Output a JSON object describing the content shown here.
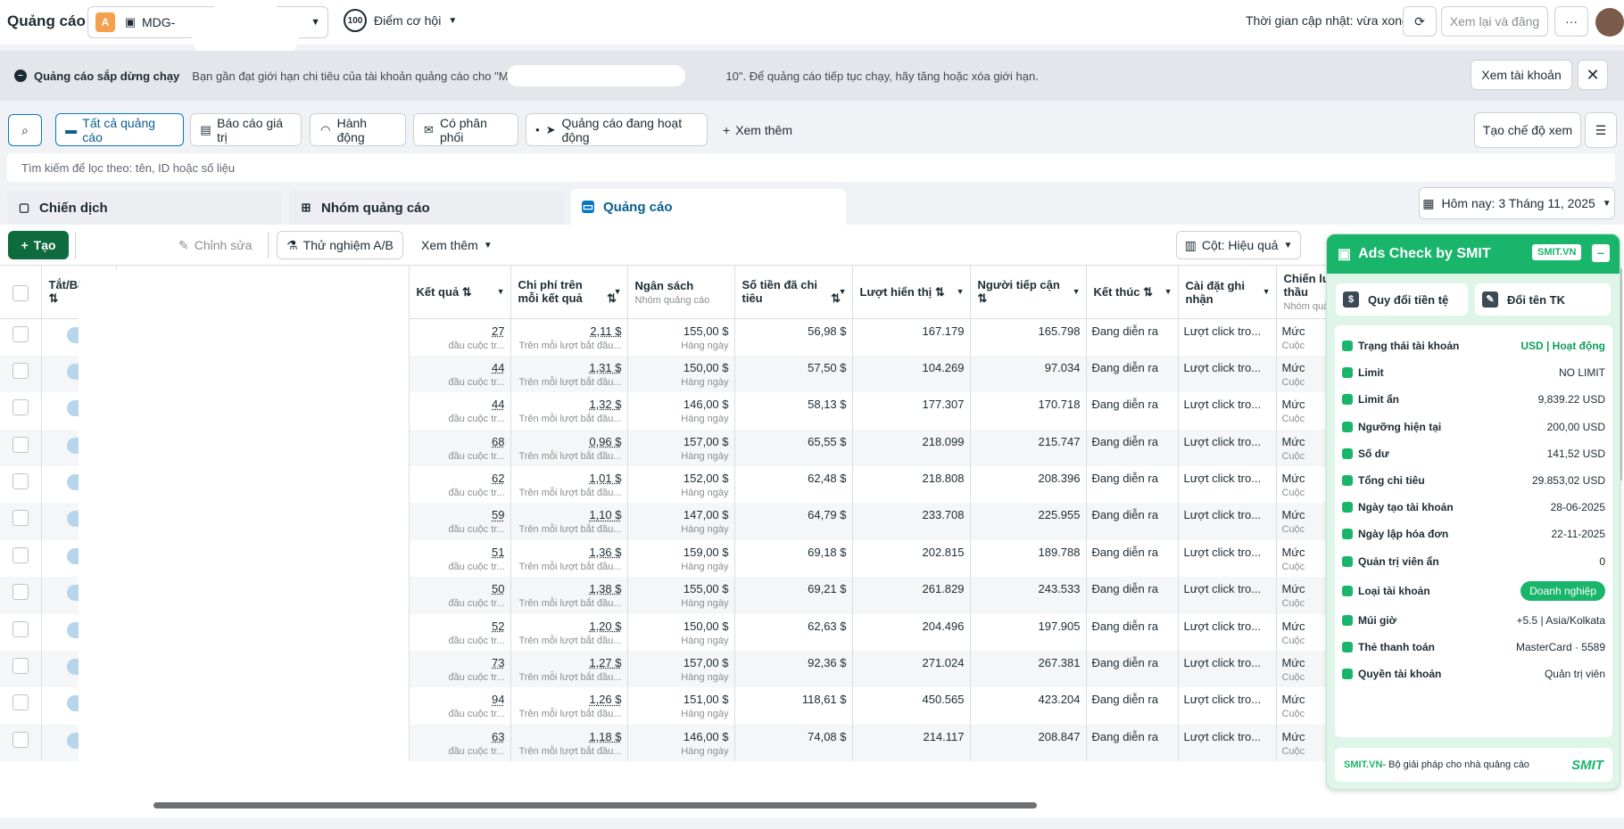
{
  "app": {
    "title": "Quảng cáo",
    "account_letter": "A",
    "account_name": "MDG-",
    "score": "100",
    "score_label": "Điểm cơ hội"
  },
  "topbar": {
    "updated": "Thời gian cập nhật: vừa xong",
    "review_label": "Xem lại và đăng",
    "more": "···"
  },
  "warning": {
    "title": "Quảng cáo sắp dừng chạy",
    "text": "Bạn gần đạt giới hạn chi tiêu của tài khoản quảng cáo cho \"MDG-",
    "text_tail": "10\". Để quảng cáo tiếp tục chạy, hãy tăng hoặc xóa giới hạn.",
    "button": "Xem tài khoản"
  },
  "filters": {
    "items": [
      "Tất cả quảng cáo",
      "Báo cáo giá trị",
      "Hành động",
      "Có phân phối",
      "Quảng cáo đang hoạt động"
    ],
    "more": "Xem thêm",
    "create_view": "Tạo chế độ xem"
  },
  "search": {
    "placeholder": "Tìm kiếm để lọc theo: tên, ID hoặc số liệu"
  },
  "tabs": [
    "Chiến dịch",
    "Nhóm quảng cáo",
    "Quảng cáo"
  ],
  "date": {
    "label": "Hôm nay: 3 Tháng 11, 2025"
  },
  "toolbar": {
    "create": "Tạo",
    "edit": "Chỉnh sửa",
    "ab": "Thử nghiệm A/B",
    "more": "Xem thêm",
    "columns": "Cột: Hiệu quả"
  },
  "table": {
    "headers": {
      "toggle": "Tắt/Bật",
      "results": "Kết quả",
      "cpr": "Chi phí trên mỗi kết quả",
      "budget": "Ngân sách",
      "budget_sub": "Nhóm quảng cáo",
      "spent": "Số tiền đã chi tiêu",
      "impr": "Lượt hiển thị",
      "reach": "Người tiếp cận",
      "end": "Kết thúc",
      "attr": "Cài đặt ghi nhận",
      "bid": "Chiến lư thầu",
      "bid_sub": "Nhóm quả"
    },
    "result_sub": "đầu cuộc tr...",
    "cpr_sub": "Trên mỗi lượt bắt đầu...",
    "budget_sub": "Hàng ngày",
    "end_val": "Đang diễn ra",
    "attr_val": "Lượt click tro...",
    "bid_val": "Mức",
    "bid_sub_val": "Cuộc",
    "rows": [
      {
        "res": "27",
        "cpr": "2,11 $",
        "budget": "155,00 $",
        "spent": "56,98 $",
        "impr": "167.179",
        "reach": "165.798",
        "on": true
      },
      {
        "res": "44",
        "cpr": "1,31 $",
        "budget": "150,00 $",
        "spent": "57,50 $",
        "impr": "104.269",
        "reach": "97.034",
        "on": true
      },
      {
        "res": "44",
        "cpr": "1,32 $",
        "budget": "146,00 $",
        "spent": "58,13 $",
        "impr": "177.307",
        "reach": "170.718",
        "on": true
      },
      {
        "res": "68",
        "cpr": "0,96 $",
        "budget": "157,00 $",
        "spent": "65,55 $",
        "impr": "218.099",
        "reach": "215.747",
        "on": true
      },
      {
        "res": "62",
        "cpr": "1,01 $",
        "budget": "152,00 $",
        "spent": "62,48 $",
        "impr": "218.808",
        "reach": "208.396",
        "on": true
      },
      {
        "res": "59",
        "cpr": "1,10 $",
        "budget": "147,00 $",
        "spent": "64,79 $",
        "impr": "233.708",
        "reach": "225.955",
        "on": true
      },
      {
        "res": "51",
        "cpr": "1,36 $",
        "budget": "159,00 $",
        "spent": "69,18 $",
        "impr": "202.815",
        "reach": "189.788",
        "on": true
      },
      {
        "res": "50",
        "cpr": "1,38 $",
        "budget": "155,00 $",
        "spent": "69,21 $",
        "impr": "261.829",
        "reach": "243.533",
        "on": false
      },
      {
        "res": "52",
        "cpr": "1,20 $",
        "budget": "150,00 $",
        "spent": "62,63 $",
        "impr": "204.496",
        "reach": "197.905",
        "on": false
      },
      {
        "res": "73",
        "cpr": "1,27 $",
        "budget": "157,00 $",
        "spent": "92,36 $",
        "impr": "271.024",
        "reach": "267.381",
        "on": false
      },
      {
        "res": "94",
        "cpr": "1,26 $",
        "budget": "151,00 $",
        "spent": "118,61 $",
        "impr": "450.565",
        "reach": "423.204",
        "on": true
      },
      {
        "res": "63",
        "cpr": "1,18 $",
        "budget": "146,00 $",
        "spent": "74,08 $",
        "impr": "214.117",
        "reach": "208.847",
        "on": true
      }
    ]
  },
  "panel": {
    "title": "Ads Check by SMIT",
    "badge": "SMIT.VN",
    "actions": [
      "Quy đổi tiền tệ",
      "Đổi tên TK"
    ],
    "rows": [
      {
        "label": "Trạng thái tài khoản",
        "value": "USD | Hoạt động"
      },
      {
        "label": "Limit",
        "value": "NO LIMIT"
      },
      {
        "label": "Limit ẩn",
        "value": "9,839.22 USD"
      },
      {
        "label": "Ngưỡng hiện tại",
        "value": "200,00 USD"
      },
      {
        "label": "Số dư",
        "value": "141,52 USD"
      },
      {
        "label": "Tổng chi tiêu",
        "value": "29.853,02 USD"
      },
      {
        "label": "Ngày tạo tài khoản",
        "value": "28-06-2025"
      },
      {
        "label": "Ngày lập hóa đơn",
        "value": "22-11-2025"
      },
      {
        "label": "Quản trị viên ẩn",
        "value": "0"
      },
      {
        "label": "Loại tài khoản",
        "value": "Doanh nghiệp"
      },
      {
        "label": "Múi giờ",
        "value": "+5.5 | Asia/Kolkata"
      },
      {
        "label": "Thẻ thanh toán",
        "value": "MasterCard · 5589"
      },
      {
        "label": "Quyền tài khoản",
        "value": "Quản trị viên"
      }
    ],
    "footer_brand": "SMIT.VN",
    "footer_text": " - Bộ giải pháp cho nhà quảng cáo",
    "logo": "SMIT"
  }
}
